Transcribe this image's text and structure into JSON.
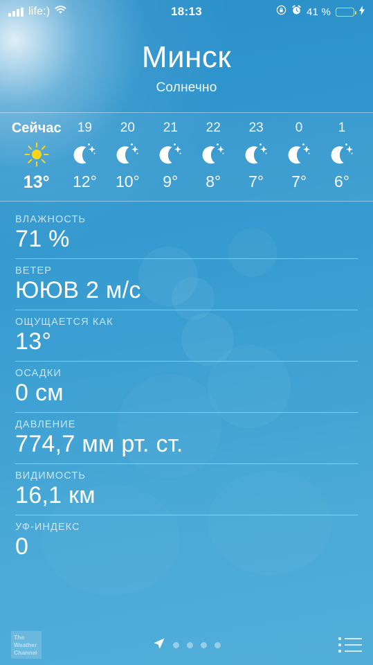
{
  "statusbar": {
    "carrier": "life:)",
    "wifi_icon": "wifi-icon",
    "signal_icon": "signal-bars-icon",
    "time": "18:13",
    "rotation_lock_icon": "rotation-lock-icon",
    "alarm_icon": "alarm-clock-icon",
    "battery_percent": "41 %",
    "battery_level": 41,
    "battery_color": "#f5d93c",
    "charging_icon": "lightning-bolt-icon"
  },
  "header": {
    "city": "Минск",
    "condition": "Солнечно"
  },
  "hourly": [
    {
      "time": "Сейчас",
      "icon": "sun-icon",
      "temp": "13°",
      "current": true
    },
    {
      "time": "19",
      "icon": "moon-icon",
      "temp": "12°",
      "current": false
    },
    {
      "time": "20",
      "icon": "moon-icon",
      "temp": "10°",
      "current": false
    },
    {
      "time": "21",
      "icon": "moon-icon",
      "temp": "9°",
      "current": false
    },
    {
      "time": "22",
      "icon": "moon-icon",
      "temp": "8°",
      "current": false
    },
    {
      "time": "23",
      "icon": "moon-icon",
      "temp": "7°",
      "current": false
    },
    {
      "time": "0",
      "icon": "moon-icon",
      "temp": "7°",
      "current": false
    },
    {
      "time": "1",
      "icon": "moon-icon",
      "temp": "6°",
      "current": false
    }
  ],
  "details": [
    {
      "label": "ВЛАЖНОСТЬ",
      "value": "71 %"
    },
    {
      "label": "ВЕТЕР",
      "value": "ЮЮВ 2 м/с"
    },
    {
      "label": "ОЩУЩАЕТСЯ КАК",
      "value": "13°"
    },
    {
      "label": "ОСАДКИ",
      "value": "0 см"
    },
    {
      "label": "ДАВЛЕНИЕ",
      "value": "774,7 мм рт. ст."
    },
    {
      "label": "ВИДИМОСТЬ",
      "value": "16,1 км"
    },
    {
      "label": "УФ-ИНДЕКС",
      "value": "0"
    }
  ],
  "bottombar": {
    "logo_line1": "The",
    "logo_line2": "Weather",
    "logo_line3": "Channel",
    "location_arrow_icon": "location-arrow-icon",
    "page_dots": 4,
    "list_icon": "list-icon"
  },
  "colors": {
    "sky_top": "#2b8fc9",
    "sky_bottom": "#52aed9",
    "sun_yellow": "#f7d417",
    "text_white": "#ffffff"
  }
}
